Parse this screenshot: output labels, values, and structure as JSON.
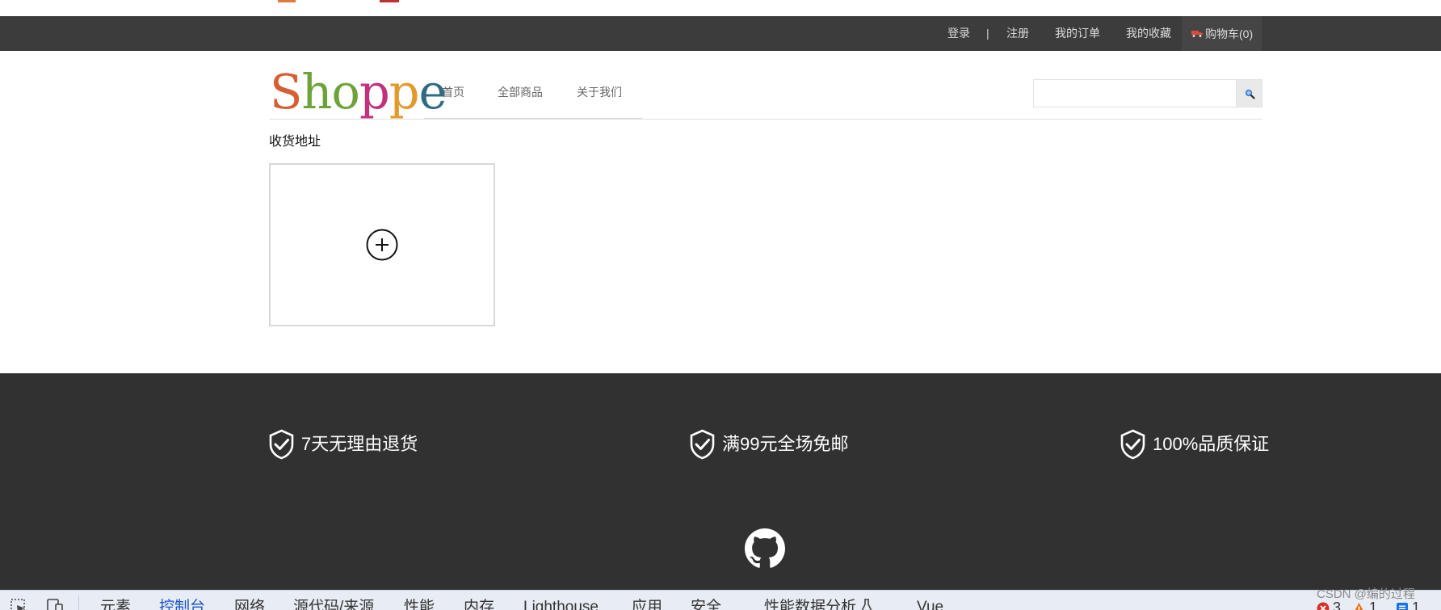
{
  "topbar": {
    "login": "登录",
    "separator": "|",
    "register": "注册",
    "my_orders": "我的订单",
    "my_favorites": "我的收藏",
    "cart": "购物车(0)"
  },
  "header": {
    "logo_letters": [
      "S",
      "h",
      "o",
      "p",
      "p",
      "e"
    ],
    "logo_colors": [
      "#d65e32",
      "#6ea33c",
      "#6ea33c",
      "#c2327c",
      "#e39a2c",
      "#2f6c82"
    ],
    "nav": [
      "首页",
      "全部商品",
      "关于我们"
    ],
    "search_value": ""
  },
  "main": {
    "section_title": "收货地址"
  },
  "footer": {
    "promises": [
      "7天无理由退货",
      "满99元全场免邮",
      "100%品质保证"
    ]
  },
  "devtools": {
    "tabs": [
      "元素",
      "控制台",
      "网络",
      "源代码/来源",
      "性能",
      "内存",
      "Lighthouse",
      "应用",
      "安全",
      "性能数据分析",
      "Vue"
    ],
    "active_tab": "控制台",
    "error_count": "3",
    "warning_count": "1",
    "info_count": "1"
  },
  "watermark": "CSDN @编的过程",
  "colors": {
    "topbar_bg": "#3c3c3c",
    "footer_bg": "#313131",
    "devtools_active": "#1a56c8"
  }
}
